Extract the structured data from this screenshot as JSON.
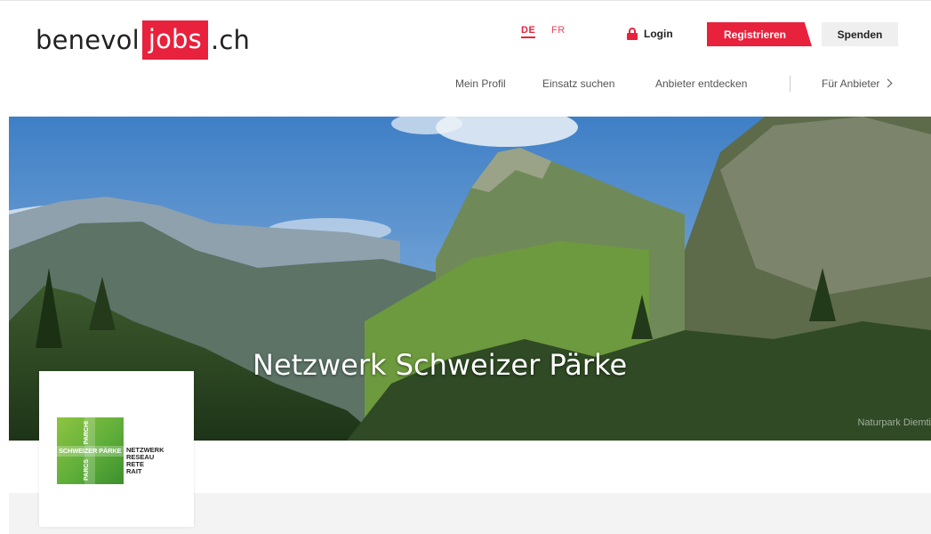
{
  "header": {
    "logo": {
      "prefix": "benevol",
      "highlight": "jobs",
      "suffix": ".ch"
    },
    "languages": [
      "DE",
      "FR"
    ],
    "active_language": "DE",
    "login_label": "Login",
    "register_label": "Registrieren",
    "donate_label": "Spenden",
    "nav": [
      "Mein Profil",
      "Einsatz suchen",
      "Anbieter entdecken",
      "Für Anbieter"
    ]
  },
  "hero": {
    "title": "Netzwerk Schweizer Pärke",
    "photo_credit": "Naturpark Diemti"
  },
  "org_logo": {
    "horizontal_text": "SCHWEIZER PÄRKE",
    "vertical_top": "PARCHI",
    "vertical_bottom": "PARCS",
    "words": [
      "NETZWERK",
      "RESEAU",
      "RETE",
      "RAIT"
    ]
  },
  "colors": {
    "brand_red": "#e8223c",
    "logo_green": "#5fae3a",
    "donate_bg": "#efefef"
  }
}
